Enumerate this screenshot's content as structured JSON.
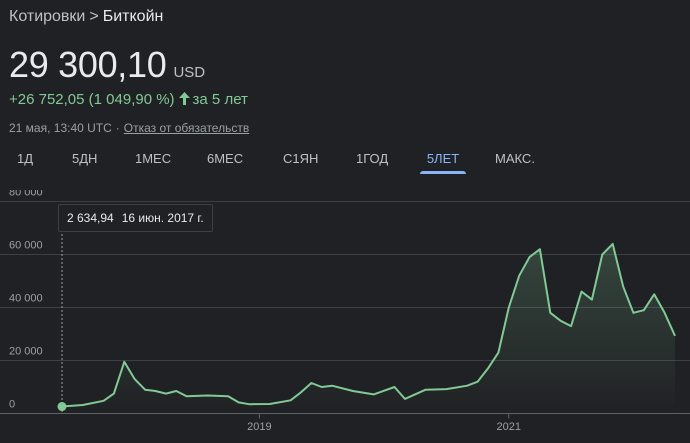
{
  "breadcrumb": {
    "parent": "Котировки",
    "separator": ">",
    "current": "Биткойн"
  },
  "price": {
    "value": "29 300,10",
    "currency": "USD"
  },
  "change": {
    "text": "+26 752,05 (1 049,90 %)",
    "arrow_icon": "arrow-up-icon",
    "period": "за 5 лет",
    "color": "#81c995"
  },
  "meta": {
    "timestamp": "21 мая, 13:40 UTC",
    "separator": "·",
    "disclaimer": "Отказ от обязательств"
  },
  "tabs": [
    {
      "label": "1Д",
      "active": false
    },
    {
      "label": "5ДН",
      "active": false
    },
    {
      "label": "1МЕС",
      "active": false
    },
    {
      "label": "6МЕС",
      "active": false
    },
    {
      "label": "С1ЯН",
      "active": false
    },
    {
      "label": "1ГОД",
      "active": false
    },
    {
      "label": "5ЛЕТ",
      "active": true
    },
    {
      "label": "МАКС.",
      "active": false
    }
  ],
  "tooltip": {
    "value": "2 634,94",
    "date": "16 июн. 2017 г."
  },
  "chart_data": {
    "type": "area",
    "xlabel": "",
    "ylabel": "",
    "ylim": [
      0,
      80000
    ],
    "y_ticks": [
      "0",
      "20 000",
      "40 000",
      "60 000",
      "80 000"
    ],
    "x_ticks": [
      "2019",
      "2021"
    ],
    "grid": true,
    "line_color": "#81c995",
    "x": [
      "2017-06",
      "2017-08",
      "2017-10",
      "2017-11",
      "2017-12",
      "2018-01",
      "2018-02",
      "2018-03",
      "2018-04",
      "2018-05",
      "2018-06",
      "2018-08",
      "2018-10",
      "2018-11",
      "2018-12",
      "2019-02",
      "2019-04",
      "2019-05",
      "2019-06",
      "2019-07",
      "2019-08",
      "2019-10",
      "2019-12",
      "2020-02",
      "2020-03",
      "2020-05",
      "2020-07",
      "2020-09",
      "2020-10",
      "2020-11",
      "2020-12",
      "2021-01",
      "2021-02",
      "2021-03",
      "2021-04",
      "2021-05",
      "2021-06",
      "2021-07",
      "2021-08",
      "2021-09",
      "2021-10",
      "2021-11",
      "2021-12",
      "2022-01",
      "2022-02",
      "2022-03",
      "2022-04",
      "2022-05"
    ],
    "y": [
      2635,
      3200,
      4800,
      7500,
      19500,
      13000,
      9000,
      8500,
      7500,
      8500,
      6500,
      6800,
      6500,
      4200,
      3500,
      3600,
      5000,
      8000,
      11500,
      10000,
      10500,
      8500,
      7200,
      10000,
      5500,
      9000,
      9200,
      10500,
      12000,
      17000,
      23000,
      40000,
      52000,
      59000,
      62000,
      38000,
      35000,
      33000,
      46000,
      43000,
      60000,
      64000,
      48000,
      38000,
      39000,
      45000,
      38000,
      29300
    ]
  }
}
